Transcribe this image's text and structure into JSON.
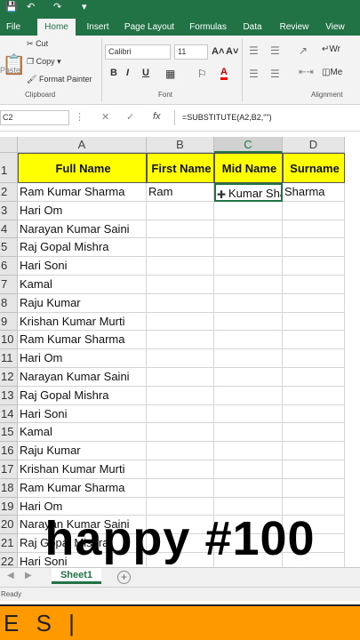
{
  "titlebar": {
    "icons": [
      "save-icon",
      "undo-icon",
      "redo-icon",
      "customize-icon"
    ]
  },
  "tabs": [
    {
      "label": "File"
    },
    {
      "label": "Home"
    },
    {
      "label": "Insert"
    },
    {
      "label": "Page Layout"
    },
    {
      "label": "Formulas"
    },
    {
      "label": "Data"
    },
    {
      "label": "Review"
    },
    {
      "label": "View"
    }
  ],
  "ribbon": {
    "paste": "Paste",
    "cut": "Cut",
    "copy": "Copy",
    "format_painter": "Format Painter",
    "clipboard": "Clipboard",
    "font_name": "Calibri",
    "font_size": "11",
    "grow": "A˄",
    "shrink": "A˅",
    "bold": "B",
    "italic": "I",
    "underline": "U",
    "font_color": "A",
    "font_group": "Font",
    "wrap": "Wr",
    "merge": "Me",
    "alignment": "Alignment"
  },
  "formula_bar": {
    "name_box": "C2",
    "fx": "fx",
    "formula": "=SUBSTITUTE(A2,B2,\"\")"
  },
  "columns": [
    {
      "letter": "A"
    },
    {
      "letter": "B"
    },
    {
      "letter": "C"
    },
    {
      "letter": "D"
    }
  ],
  "headers": [
    "Full Name",
    "First Name",
    "Mid Name",
    "Surname"
  ],
  "rows": [
    {
      "n": "1"
    },
    {
      "n": "2",
      "a": "Ram Kumar Sharma",
      "b": "Ram",
      "c": "Kumar Sharma",
      "d": "Sharma"
    },
    {
      "n": "3",
      "a": "Hari Om"
    },
    {
      "n": "4",
      "a": "Narayan Kumar Saini"
    },
    {
      "n": "5",
      "a": "Raj Gopal Mishra"
    },
    {
      "n": "6",
      "a": "Hari Soni"
    },
    {
      "n": "7",
      "a": "Kamal"
    },
    {
      "n": "8",
      "a": "Raju Kumar"
    },
    {
      "n": "9",
      "a": "Krishan Kumar Murti"
    },
    {
      "n": "10",
      "a": "Ram Kumar Sharma"
    },
    {
      "n": "11",
      "a": "Hari Om"
    },
    {
      "n": "12",
      "a": "Narayan Kumar Saini"
    },
    {
      "n": "13",
      "a": "Raj Gopal Mishra"
    },
    {
      "n": "14",
      "a": "Hari Soni"
    },
    {
      "n": "15",
      "a": "Kamal"
    },
    {
      "n": "16",
      "a": "Raju Kumar"
    },
    {
      "n": "17",
      "a": "Krishan Kumar Murti"
    },
    {
      "n": "18",
      "a": "Ram Kumar Sharma"
    },
    {
      "n": "19",
      "a": "Hari Om"
    },
    {
      "n": "20",
      "a": "Narayan Kumar Saini"
    },
    {
      "n": "21",
      "a": "Raj Gopal Mishra"
    },
    {
      "n": "22",
      "a": "Hari Soni"
    }
  ],
  "sheet_tab": "Sheet1",
  "add_sheet": "+",
  "status": "Ready",
  "overlay_text": "happy #100",
  "bottom_text": "E S |",
  "colors": {
    "excel_green": "#217346",
    "header_fill": "#ffff00",
    "orange": "#ff9900"
  }
}
